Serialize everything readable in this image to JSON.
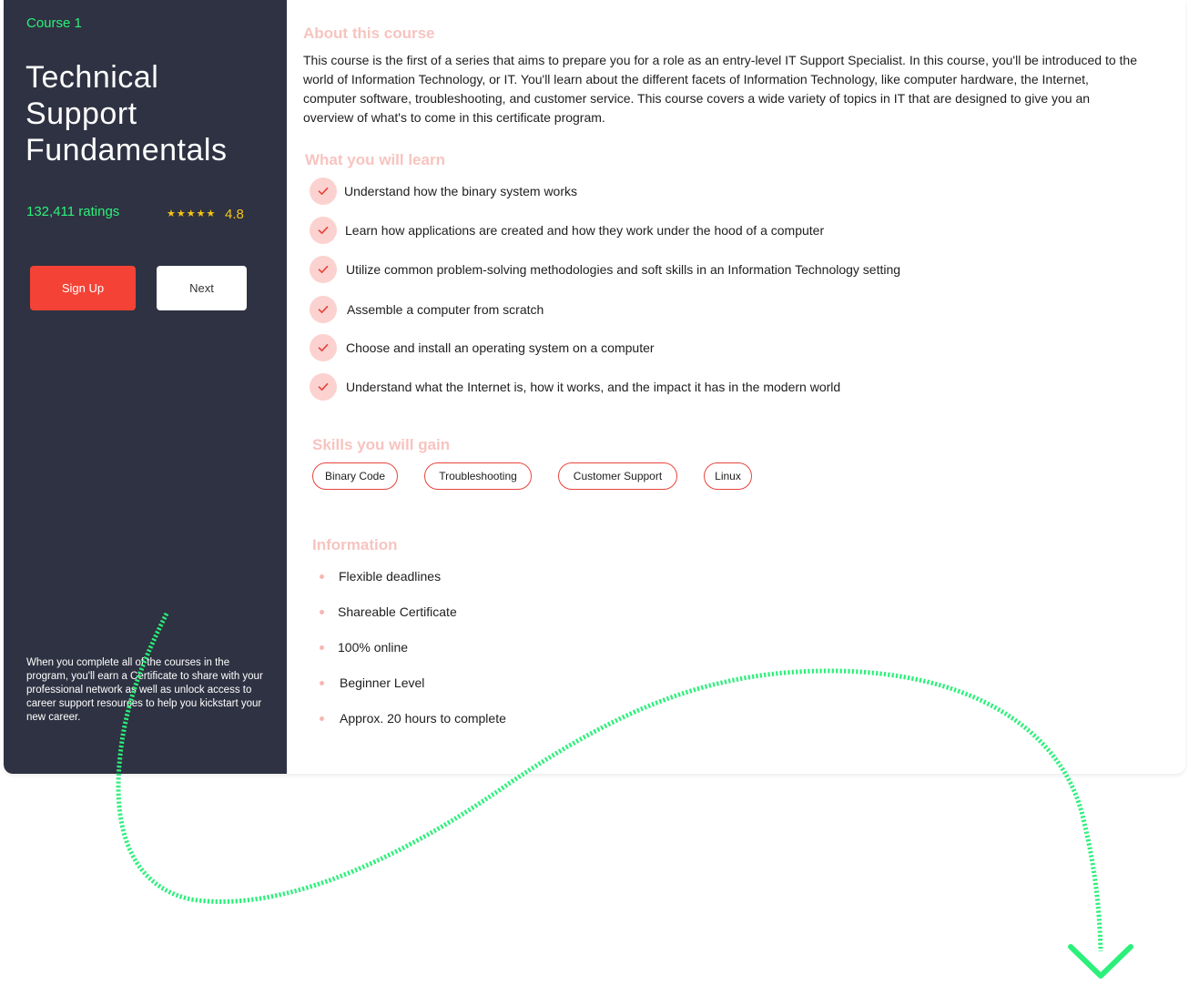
{
  "sidebar": {
    "course_label": "Course 1",
    "title": "Technical Support Fundamentals",
    "ratings_count": "132,411 ratings",
    "stars": "★★★★★",
    "rating_value": "4.8",
    "signup_label": "Sign Up",
    "next_label": "Next",
    "certificate_note": "When you complete all of the courses in the program, you'll earn a Certificate to share with your professional network as well as unlock access to career support resources to help you kickstart your new career."
  },
  "about": {
    "heading": "About this course",
    "text": "This course is the first of a series that aims to prepare you for a role as an entry-level IT Support Specialist. In this course, you'll be introduced to the world of Information Technology, or IT. You'll learn about the different facets of Information Technology, like computer hardware, the Internet, computer software, troubleshooting, and customer service. This course covers a wide variety of topics in IT that are designed to give you an overview of what's to come in this certificate program."
  },
  "learn": {
    "heading": "What you will learn",
    "items": [
      "Understand how the binary system works",
      "Learn how applications are created and how they work under the hood of a computer",
      "Utilize common problem-solving methodologies and soft skills in an Information Technology setting",
      "Assemble a computer from scratch",
      "Choose and install an operating system on a computer",
      "Understand what the Internet is, how it works, and the impact it has in the modern world"
    ]
  },
  "skills": {
    "heading": "Skills you will gain",
    "items": [
      "Binary Code",
      "Troubleshooting",
      "Customer Support",
      "Linux"
    ]
  },
  "information": {
    "heading": "Information",
    "items": [
      "Flexible deadlines",
      "Shareable Certificate",
      "100% online",
      "Beginner Level",
      "Approx. 20 hours to complete"
    ]
  },
  "colors": {
    "sidebar_bg": "#2f3242",
    "accent_green": "#2bf07a",
    "accent_red": "#f44336",
    "heading_pink": "#f7c4c0",
    "star_yellow": "#f5c518",
    "check_bg": "#fbd2cf"
  }
}
